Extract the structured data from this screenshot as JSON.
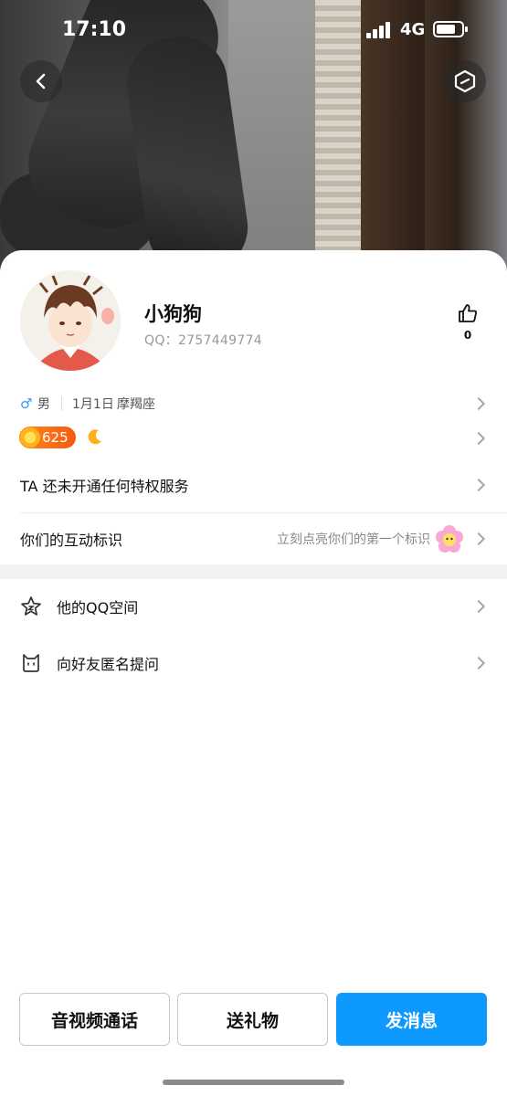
{
  "status_bar": {
    "time": "17:10",
    "network": "4G",
    "battery_level": 0.75
  },
  "header": {
    "back_icon": "chevron-left-icon",
    "action_icon": "hexagon-icon"
  },
  "profile": {
    "name": "小狗狗",
    "qq_label": "QQ：2757449774",
    "likes": "0",
    "gender": "男",
    "birthday": "1月1日",
    "zodiac": "摩羯座",
    "level": "625"
  },
  "rows": {
    "privilege": "TA 还未开通任何特权服务",
    "interaction_label": "你们的互动标识",
    "interaction_hint": "立刻点亮你们的第一个标识"
  },
  "menu": [
    {
      "label": "他的QQ空间",
      "icon": "star-icon"
    },
    {
      "label": "向好友匿名提问",
      "icon": "cat-icon"
    }
  ],
  "actions": {
    "call": "音视频通话",
    "gift": "送礼物",
    "message": "发消息"
  },
  "colors": {
    "accent": "#0d99fe",
    "male": "#3a9bf0",
    "level_badge": "#f35a11"
  }
}
